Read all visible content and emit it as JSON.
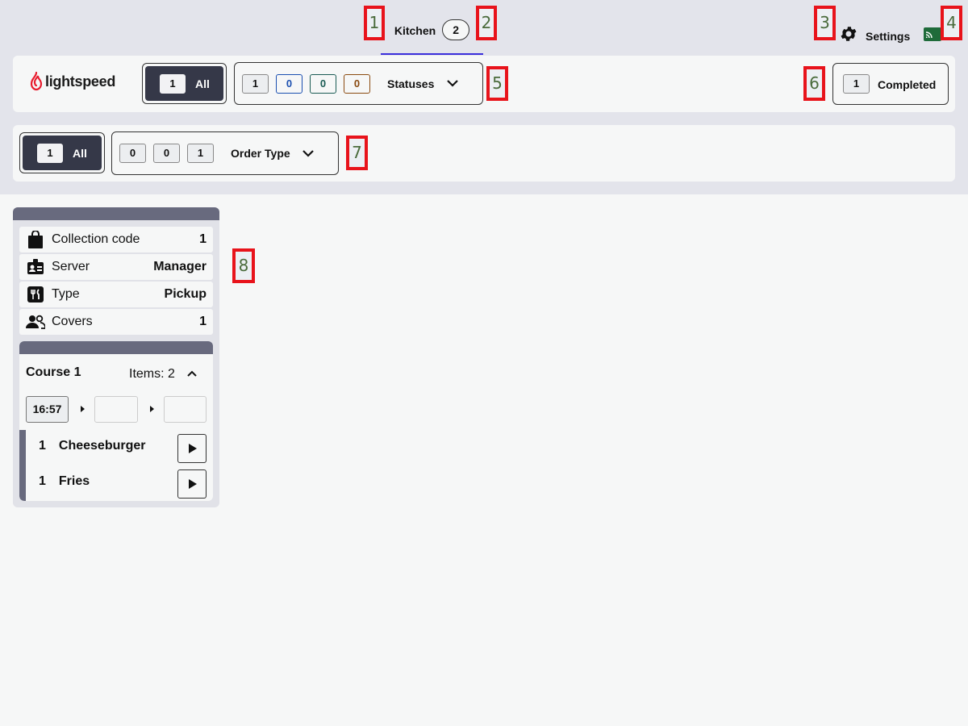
{
  "header": {
    "tab_label": "Kitchen",
    "tab_count": "2",
    "settings_label": "Settings",
    "accent_color": "#3b2fdb",
    "cast_color": "#1f6b3a"
  },
  "markers": [
    "1",
    "2",
    "3",
    "4",
    "5",
    "6",
    "7",
    "8"
  ],
  "brand": {
    "logo_text": "lightspeed",
    "logo_color": "#e81c2e"
  },
  "status_filters": {
    "all": {
      "count": "1",
      "label": "All"
    },
    "chips": [
      "1",
      "0",
      "0",
      "0"
    ],
    "chip_colors": [
      "#111111",
      "#1a4fb0",
      "#1a5b54",
      "#8a4a10"
    ],
    "label": "Statuses"
  },
  "completed": {
    "count": "1",
    "label": "Completed"
  },
  "order_type_filters": {
    "all": {
      "count": "1",
      "label": "All"
    },
    "chips": [
      "0",
      "0",
      "1"
    ],
    "label": "Order Type"
  },
  "order_card": {
    "info": [
      {
        "icon": "shopping-bag-icon",
        "key": "Collection code",
        "value": "1"
      },
      {
        "icon": "id-badge-icon",
        "key": "Server",
        "value": "Manager"
      },
      {
        "icon": "utensils-icon",
        "key": "Type",
        "value": "Pickup"
      },
      {
        "icon": "users-icon",
        "key": "Covers",
        "value": "1"
      }
    ],
    "course": {
      "title": "Course 1",
      "items_label": "Items: 2",
      "time": "16:57",
      "items": [
        {
          "qty": "1",
          "name": "Cheeseburger"
        },
        {
          "qty": "1",
          "name": "Fries"
        }
      ]
    }
  }
}
